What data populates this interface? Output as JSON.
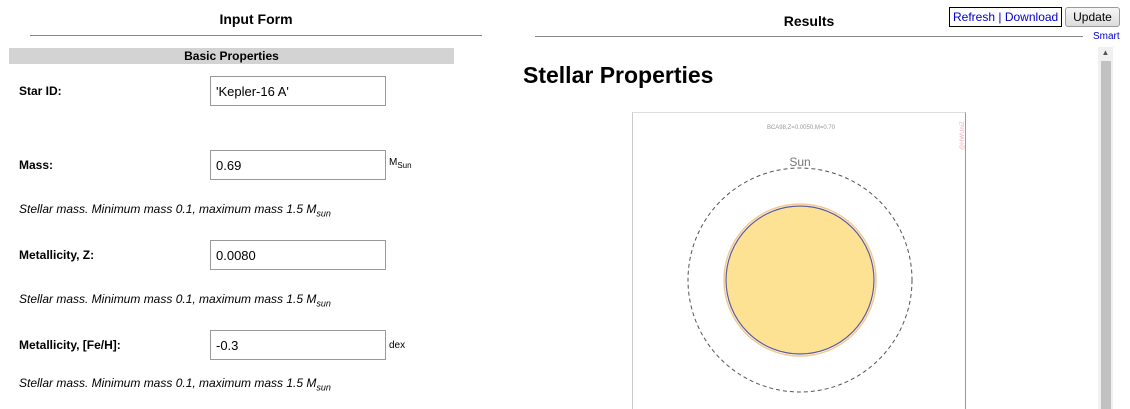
{
  "input_form": {
    "title": "Input Form",
    "section": "Basic Properties",
    "fields": [
      {
        "label": "Star ID:",
        "value": "'Kepler-16 A'"
      },
      {
        "label": "Mass:",
        "value": "0.69",
        "unit_main": "M",
        "unit_sub": "Sun",
        "help_main": "Stellar mass. Minimum mass 0.1, maximum mass 1.5 M",
        "help_sub": "sun"
      },
      {
        "label": "Metallicity, Z:",
        "value": "0.0080",
        "help_main": "Stellar mass. Minimum mass 0.1, maximum mass 1.5 M",
        "help_sub": "sun"
      },
      {
        "label": "Metallicity, [Fe/H]:",
        "value": "-0.3",
        "unit_main": "dex",
        "help_main": "Stellar mass. Minimum mass 0.1, maximum mass 1.5 M",
        "help_sub": "sun"
      }
    ]
  },
  "results": {
    "title": "Results",
    "refresh_label": "Refresh",
    "separator": "|",
    "download_label": "Download",
    "update_label": "Update",
    "smart_label": "Smart",
    "heading": "Stellar Properties",
    "plot": {
      "caption": "BCA98,Z=0.0050,M=0.70",
      "watermark": "@HWUniZ",
      "sun_label": "Sun",
      "star_fill": "#fde293",
      "star_edge": "#5b5b9a",
      "sun_ring": "#555555"
    }
  }
}
